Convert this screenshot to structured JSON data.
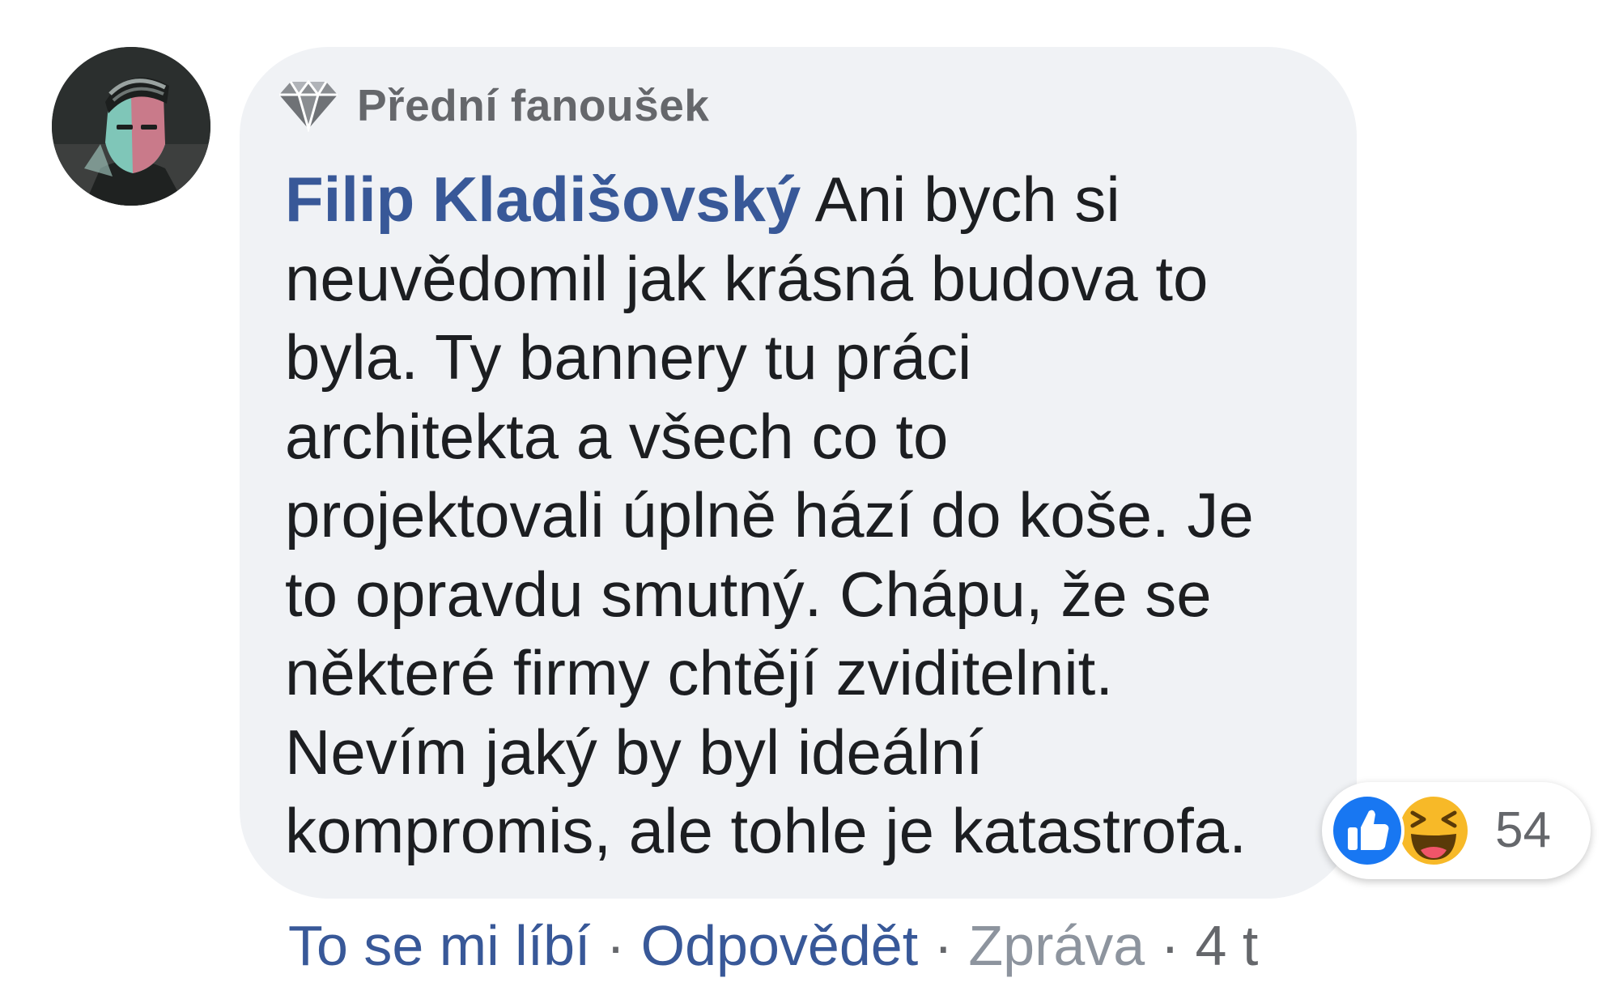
{
  "badge": {
    "icon": "diamond-icon",
    "label": "Přední fanoušek"
  },
  "comment": {
    "author": "Filip Kladišovský",
    "lines": [
      " Ani bych si",
      "neuvědomil jak krásná budova to",
      "byla. Ty bannery tu práci",
      "architekta a všech co to",
      "projektovali úplně hází do koše. Je",
      "to opravdu smutný. Chápu, že se",
      "některé firmy chtějí zviditelnit.",
      "Nevím jaký by byl ideální",
      "kompromis, ale tohle je katastrofa."
    ]
  },
  "reactions": {
    "icons": [
      "like-reaction-icon",
      "haha-reaction-icon"
    ],
    "count": "54"
  },
  "actions": {
    "like": "To se mi líbí",
    "reply": "Odpovědět",
    "message": "Zpráva",
    "time": "4 t",
    "separator": " · "
  },
  "colors": {
    "bubble": "#f0f2f5",
    "author": "#385898",
    "link": "#385898",
    "secondary": "#65676b",
    "muted": "#8d949e",
    "like_blue": "#1877f2",
    "haha_yellow": "#f7b928"
  }
}
